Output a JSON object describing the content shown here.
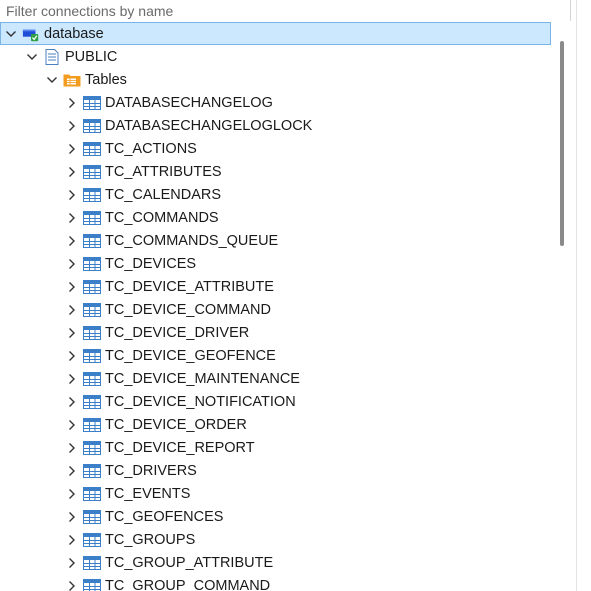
{
  "filter": {
    "placeholder": "Filter connections by name",
    "value": ""
  },
  "tree": {
    "connection": {
      "label": "database",
      "expanded": true,
      "selected": true,
      "icon": "database-connected-icon"
    },
    "schema": {
      "label": "PUBLIC",
      "expanded": true,
      "icon": "schema-icon"
    },
    "folder": {
      "label": "Tables",
      "expanded": true,
      "icon": "tables-folder-icon"
    },
    "tables": [
      "DATABASECHANGELOG",
      "DATABASECHANGELOGLOCK",
      "TC_ACTIONS",
      "TC_ATTRIBUTES",
      "TC_CALENDARS",
      "TC_COMMANDS",
      "TC_COMMANDS_QUEUE",
      "TC_DEVICES",
      "TC_DEVICE_ATTRIBUTE",
      "TC_DEVICE_COMMAND",
      "TC_DEVICE_DRIVER",
      "TC_DEVICE_GEOFENCE",
      "TC_DEVICE_MAINTENANCE",
      "TC_DEVICE_NOTIFICATION",
      "TC_DEVICE_ORDER",
      "TC_DEVICE_REPORT",
      "TC_DRIVERS",
      "TC_EVENTS",
      "TC_GEOFENCES",
      "TC_GROUPS",
      "TC_GROUP_ATTRIBUTE",
      "TC_GROUP_COMMAND"
    ]
  },
  "colors": {
    "selection_bg": "#cce8ff",
    "selection_border": "#7ab3e6",
    "table_icon": "#3c7fc9",
    "folder_icon": "#f39c1f",
    "db_icon": "#1f4fd6",
    "connected_badge": "#2ea043"
  }
}
